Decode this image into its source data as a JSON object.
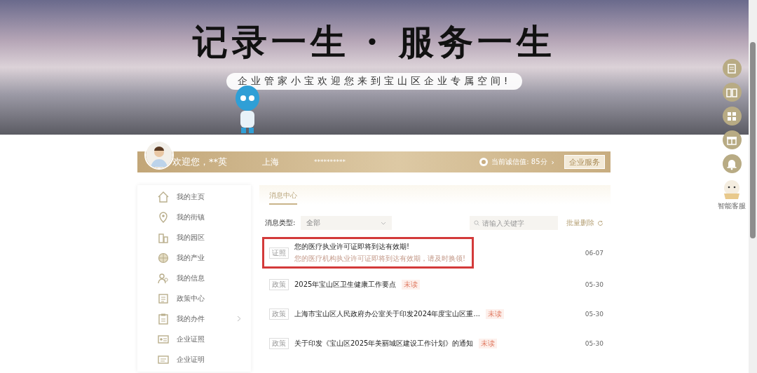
{
  "banner": {
    "slogan": "记录一生 · 服务一生",
    "welcome": "企业管家小宝欢迎您来到宝山区企业专属空间!"
  },
  "user_bar": {
    "greeting": "欢迎您，**英",
    "city": "上海",
    "masked_id": "**********",
    "credit": "当前诚信值: 85分",
    "credit_arrow": "›",
    "button": "企业服务"
  },
  "sidebar": {
    "items": [
      {
        "label": "我的主页",
        "expandable": false
      },
      {
        "label": "我的街镇",
        "expandable": false
      },
      {
        "label": "我的园区",
        "expandable": false
      },
      {
        "label": "我的产业",
        "expandable": false
      },
      {
        "label": "我的信息",
        "expandable": false
      },
      {
        "label": "政策中心",
        "expandable": false
      },
      {
        "label": "我的办件",
        "expandable": true
      },
      {
        "label": "企业证照",
        "expandable": false
      },
      {
        "label": "企业证明",
        "expandable": false
      }
    ]
  },
  "content": {
    "tab": "消息中心",
    "filter_label": "消息类型:",
    "filter_value": "全部",
    "search": {
      "placeholder": "请输入关键字"
    },
    "bulk_action": "批量删除",
    "messages": [
      {
        "tag": "证照",
        "title": "您的医疗执业许可证即将到达有效期!",
        "subtitle": "您的医疗机构执业许可证即将到达有效期，请及时换领!",
        "date": "06-07",
        "highlighted": true
      },
      {
        "tag": "政策",
        "title": "2025年宝山区卫生健康工作要点",
        "badge": "未读",
        "date": "05-30",
        "highlighted": false
      },
      {
        "tag": "政策",
        "title": "上海市宝山区人民政府办公室关于印发2024年度宝山区重...",
        "badge": "未读",
        "date": "05-30",
        "highlighted": false
      },
      {
        "tag": "政策",
        "title": "关于印发《宝山区2025年美丽城区建设工作计划》的通知",
        "badge": "未读",
        "date": "05-30",
        "highlighted": false
      }
    ]
  },
  "float_tools": {
    "assistant_label": "智能客服"
  }
}
